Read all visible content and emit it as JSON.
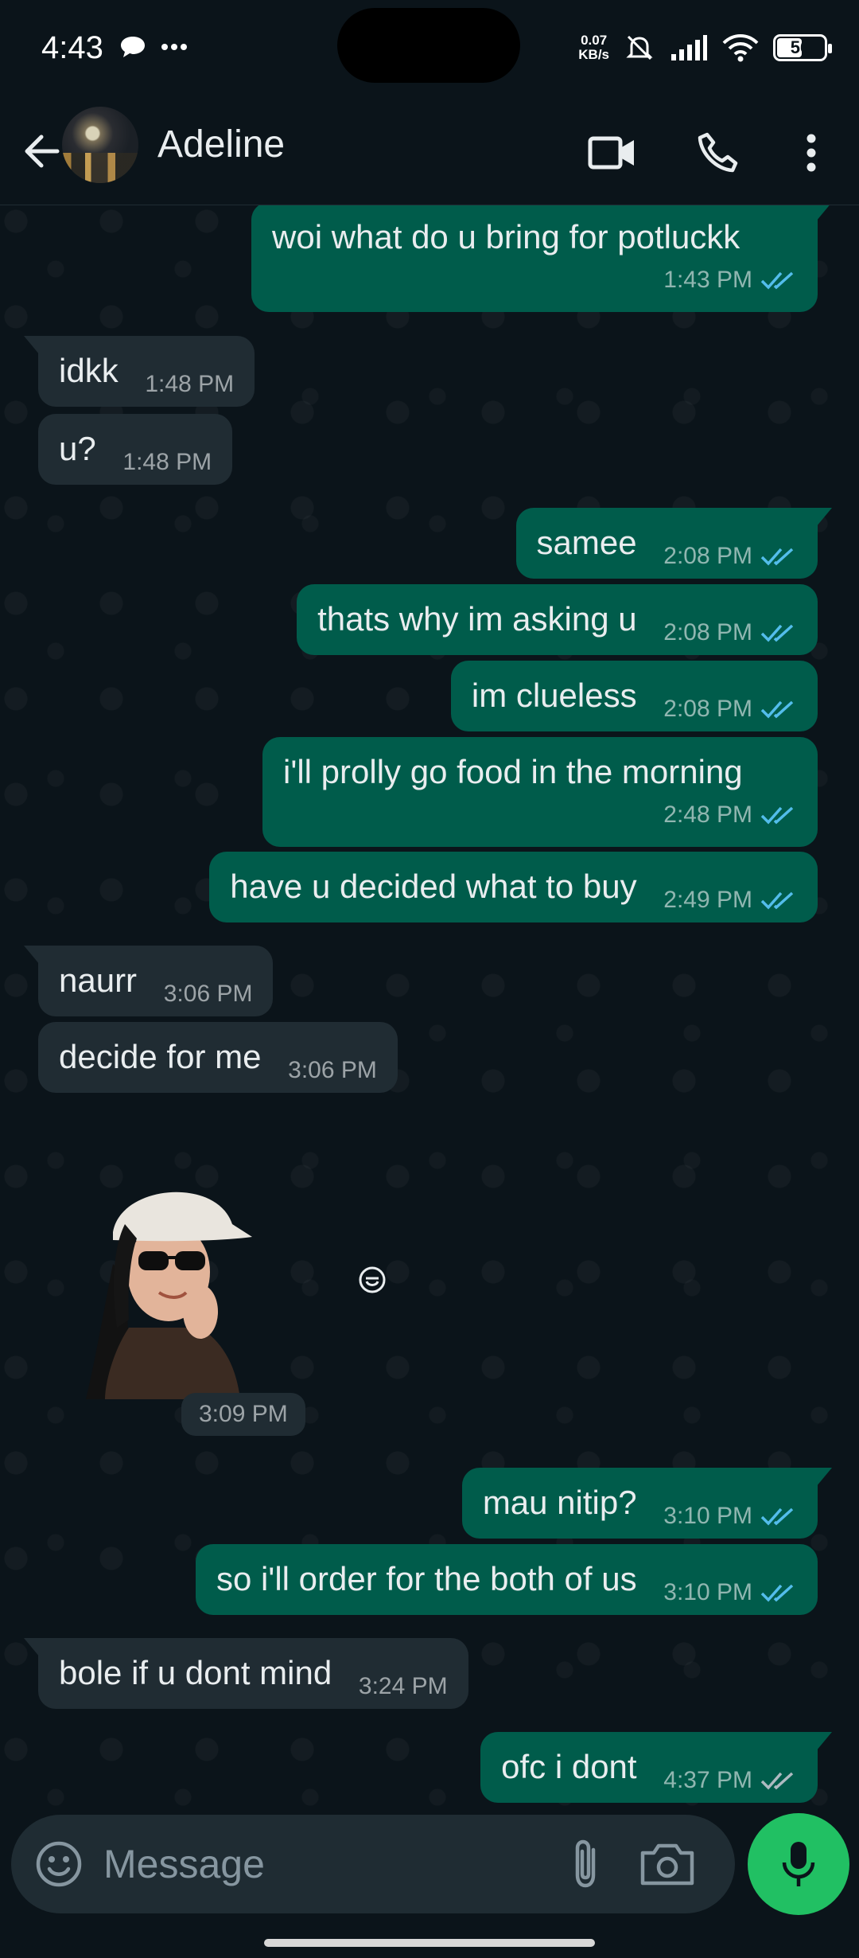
{
  "status_bar": {
    "time": "4:43",
    "net_speed_value": "0.07",
    "net_speed_unit": "KB/s",
    "battery": "56",
    "battery_level": 0.56
  },
  "header": {
    "contact_name": "Adeline",
    "icons": [
      "back-arrow-icon",
      "video-call-icon",
      "phone-icon",
      "more-vert-icon"
    ]
  },
  "messages": [
    {
      "dir": "out",
      "text": "woi what do u bring for potluckk",
      "time": "1:43 PM",
      "status": "read"
    },
    {
      "dir": "in",
      "text": "idkk",
      "time": "1:48 PM"
    },
    {
      "dir": "in",
      "text": "u?",
      "time": "1:48 PM"
    },
    {
      "dir": "out",
      "text": "samee",
      "time": "2:08 PM",
      "status": "read"
    },
    {
      "dir": "out",
      "text": "thats why im asking u",
      "time": "2:08 PM",
      "status": "read"
    },
    {
      "dir": "out",
      "text": "im clueless",
      "time": "2:08 PM",
      "status": "read"
    },
    {
      "dir": "out",
      "text": "i'll prolly go food in the morning",
      "time": "2:48 PM",
      "status": "read"
    },
    {
      "dir": "out",
      "text": "have u decided what to buy",
      "time": "2:49 PM",
      "status": "read"
    },
    {
      "dir": "in",
      "text": "naurr",
      "time": "3:06 PM"
    },
    {
      "dir": "in",
      "text": "decide for me",
      "time": "3:06 PM"
    },
    {
      "dir": "in",
      "type": "sticker",
      "time": "3:09 PM"
    },
    {
      "dir": "out",
      "text": "mau nitip?",
      "time": "3:10 PM",
      "status": "read"
    },
    {
      "dir": "out",
      "text": "so i'll order for the both of us",
      "time": "3:10 PM",
      "status": "read"
    },
    {
      "dir": "in",
      "text": "bole if u dont mind",
      "time": "3:24 PM"
    },
    {
      "dir": "out",
      "text": "ofc i dont",
      "time": "4:37 PM",
      "status": "delivered"
    }
  ],
  "input": {
    "placeholder": "Message"
  },
  "colors": {
    "outgoing_bubble": "#005c4b",
    "incoming_bubble": "#202c33",
    "read_tick": "#53bdeb",
    "delivered_tick": "#8696a0",
    "mic_button": "#21c063",
    "background": "#0b141a"
  }
}
